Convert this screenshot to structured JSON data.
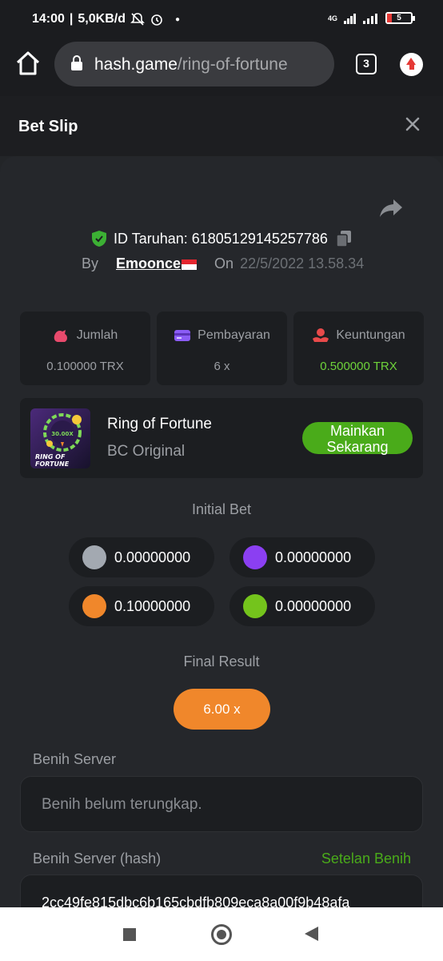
{
  "status_bar": {
    "time": "14:00",
    "speed": "5,0KB/d",
    "network": "4G",
    "battery": "5"
  },
  "browser": {
    "url_host": "hash.game",
    "url_path": "/ring-of-fortune",
    "tab_count": "3"
  },
  "header": {
    "title": "Bet Slip"
  },
  "bet": {
    "id_label": "ID Taruhan: 61805129145257786",
    "by_label": "By",
    "user": "Emoonce",
    "on_label": "On",
    "date": "22/5/2022 13.58.34"
  },
  "stats": [
    {
      "label": "Jumlah",
      "value": "0.100000 TRX",
      "icon": "money-bag-icon"
    },
    {
      "label": "Pembayaran",
      "value": "6 x",
      "icon": "credit-card-icon"
    },
    {
      "label": "Keuntungan",
      "value": "0.500000 TRX",
      "icon": "hand-coin-icon"
    }
  ],
  "game": {
    "name": "Ring of Fortune",
    "provider": "BC Original",
    "play_label": "Mainkan Sekarang",
    "thumb_multiplier": "30.00X",
    "thumb_title_1": "RING OF",
    "thumb_title_2": "FORTUNE"
  },
  "initial_bet": {
    "title": "Initial Bet",
    "chips": [
      {
        "color": "#a3a9b1",
        "amount": "0.00000000"
      },
      {
        "color": "#8b3ff2",
        "amount": "0.00000000"
      },
      {
        "color": "#f0872b",
        "amount": "0.10000000"
      },
      {
        "color": "#74c41c",
        "amount": "0.00000000"
      }
    ]
  },
  "final_result": {
    "title": "Final Result",
    "value": "6.00 x"
  },
  "server_seed": {
    "label": "Benih Server",
    "value": "Benih belum terungkap."
  },
  "server_seed_hash": {
    "label": "Benih Server (hash)",
    "link": "Setelan Benih",
    "value": "2cc49fe815dbc6b165cbdfb809eca8a00f9b48afa"
  },
  "colors": {
    "accent_green": "#4aab1a",
    "profit_green": "#6ed33a",
    "result_orange": "#f0872b",
    "background": "#25272b",
    "card": "#1c1e21"
  }
}
